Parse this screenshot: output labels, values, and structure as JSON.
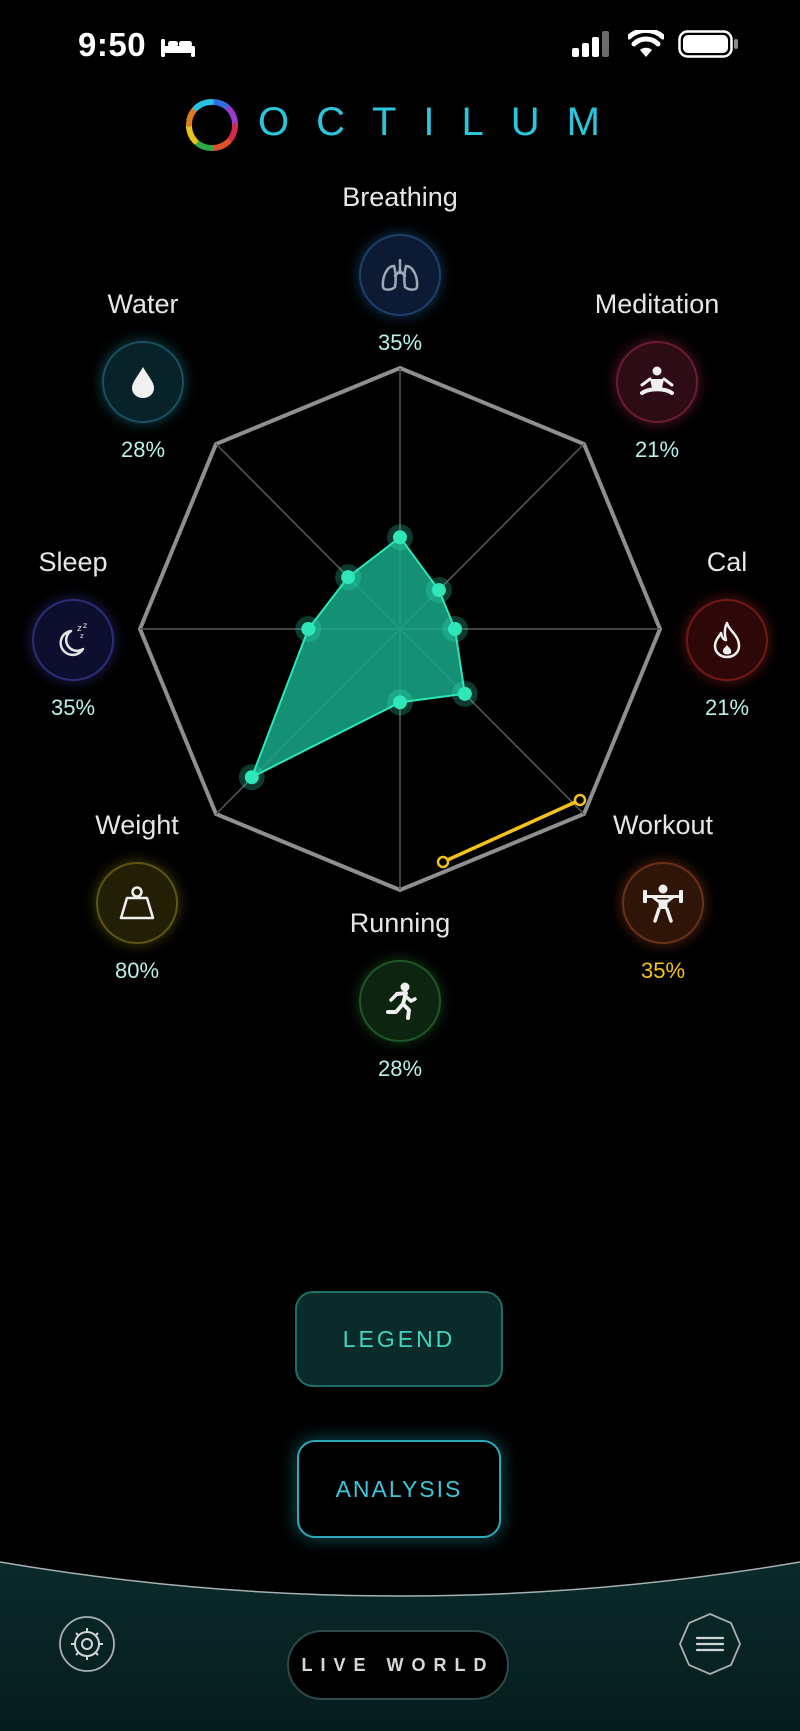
{
  "status": {
    "time": "9:50",
    "sleep_icon": "bed-icon",
    "signal_icon": "cellular-signal-icon",
    "wifi_icon": "wifi-icon",
    "battery_icon": "battery-icon"
  },
  "app": {
    "title": "OCTILUM",
    "logo_icon": "octilum-ring-logo-icon"
  },
  "metrics": {
    "breathing": {
      "label": "Breathing",
      "value": "35%",
      "icon": "lungs-icon",
      "color": "#2a6fb0"
    },
    "meditation": {
      "label": "Meditation",
      "value": "21%",
      "icon": "meditation-icon",
      "color": "#b0304f"
    },
    "cal": {
      "label": "Cal",
      "value": "21%",
      "icon": "flame-icon",
      "color": "#c0282a"
    },
    "workout": {
      "label": "Workout",
      "value": "35%",
      "icon": "weightlifting-icon",
      "color": "#b5502a"
    },
    "running": {
      "label": "Running",
      "value": "28%",
      "icon": "running-icon",
      "color": "#2c7a35"
    },
    "weight": {
      "label": "Weight",
      "value": "80%",
      "icon": "weight-icon",
      "color": "#8a7d1e"
    },
    "sleep": {
      "label": "Sleep",
      "value": "35%",
      "icon": "moon-icon",
      "color": "#3a3ca8"
    },
    "water": {
      "label": "Water",
      "value": "28%",
      "icon": "water-drop-icon",
      "color": "#2a90a8"
    }
  },
  "chart_data": {
    "type": "radar",
    "axes": [
      "Breathing",
      "Meditation",
      "Cal",
      "Workout",
      "Running",
      "Weight",
      "Sleep",
      "Water"
    ],
    "values": [
      35,
      21,
      21,
      35,
      28,
      80,
      35,
      28
    ],
    "max": 100
  },
  "buttons": {
    "legend": "LEGEND",
    "analysis": "ANALYSIS"
  },
  "bottom_nav": {
    "live_world": "LIVE WORLD",
    "settings_icon": "settings-gear-icon",
    "menu_icon": "menu-icon"
  },
  "colors": {
    "accent": "#2ee6b8",
    "brand": "#29c6dc",
    "highlight": "#f5c21b",
    "radar_fill": "#17a98a"
  }
}
